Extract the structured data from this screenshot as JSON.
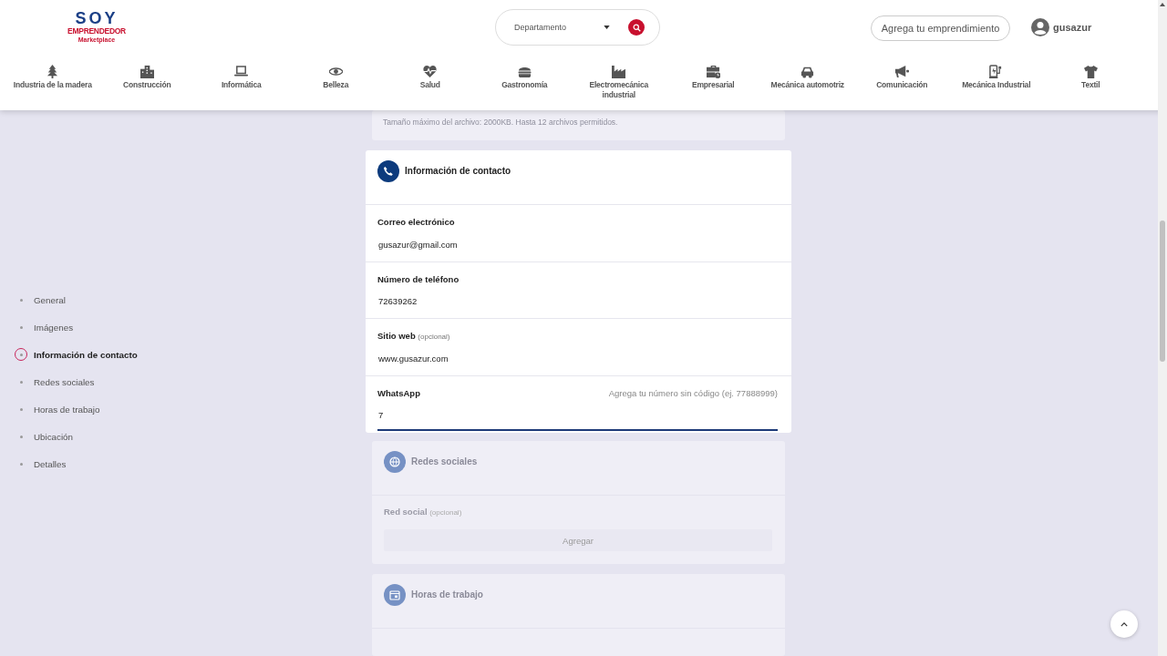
{
  "header": {
    "logo": {
      "title": "SOY",
      "band": "EMPRENDEDOR",
      "tagline": "Marketplace"
    },
    "search": {
      "placeholder": "Departamento"
    },
    "add_button": "Agrega tu emprendimiento",
    "user": "gusazur"
  },
  "categories": [
    {
      "label": "Industria de la madera",
      "kind": "tree"
    },
    {
      "label": "Construcción",
      "kind": "buildings"
    },
    {
      "label": "Informática",
      "kind": "laptop"
    },
    {
      "label": "Belleza",
      "kind": "eye"
    },
    {
      "label": "Salud",
      "kind": "heart"
    },
    {
      "label": "Gastronomía",
      "kind": "burger"
    },
    {
      "label": "Electromecánica industrial",
      "kind": "factory"
    },
    {
      "label": "Empresarial",
      "kind": "briefcase"
    },
    {
      "label": "Mecánica automotriz",
      "kind": "car"
    },
    {
      "label": "Comunicación",
      "kind": "megaphone"
    },
    {
      "label": "Mecánica Industrial",
      "kind": "charger"
    },
    {
      "label": "Textil",
      "kind": "shirt"
    }
  ],
  "section_nav": [
    {
      "label": "General",
      "selected": false
    },
    {
      "label": "Imágenes",
      "selected": false
    },
    {
      "label": "Información de contacto",
      "selected": true
    },
    {
      "label": "Redes sociales",
      "selected": false
    },
    {
      "label": "Horas de trabajo",
      "selected": false
    },
    {
      "label": "Ubicación",
      "selected": false
    },
    {
      "label": "Detalles",
      "selected": false
    }
  ],
  "images_card": {
    "active": false,
    "note": "Tamaño máximo del archivo: 2000KB. Hasta 12 archivos permitidos."
  },
  "contact_card": {
    "active": true,
    "title": "Información de contacto",
    "fields": [
      {
        "label": "Correo electrónico",
        "value": "gusazur@gmail.com",
        "focused": false
      },
      {
        "label": "Número de teléfono",
        "value": "72639262",
        "focused": false
      },
      {
        "label": "Sitio web",
        "note": "(opcional)",
        "value": "www.gusazur.com",
        "focused": false
      },
      {
        "label": "WhatsApp",
        "hint": "Agrega tu número sin código (ej. 77888999)",
        "value": "7",
        "focused": true
      }
    ]
  },
  "social_card": {
    "active": false,
    "title": "Redes sociales",
    "field_label": "Red social",
    "field_note": "(opcional)",
    "add_button": "Agregar"
  },
  "hours_card": {
    "active": false,
    "title": "Horas de trabajo"
  }
}
